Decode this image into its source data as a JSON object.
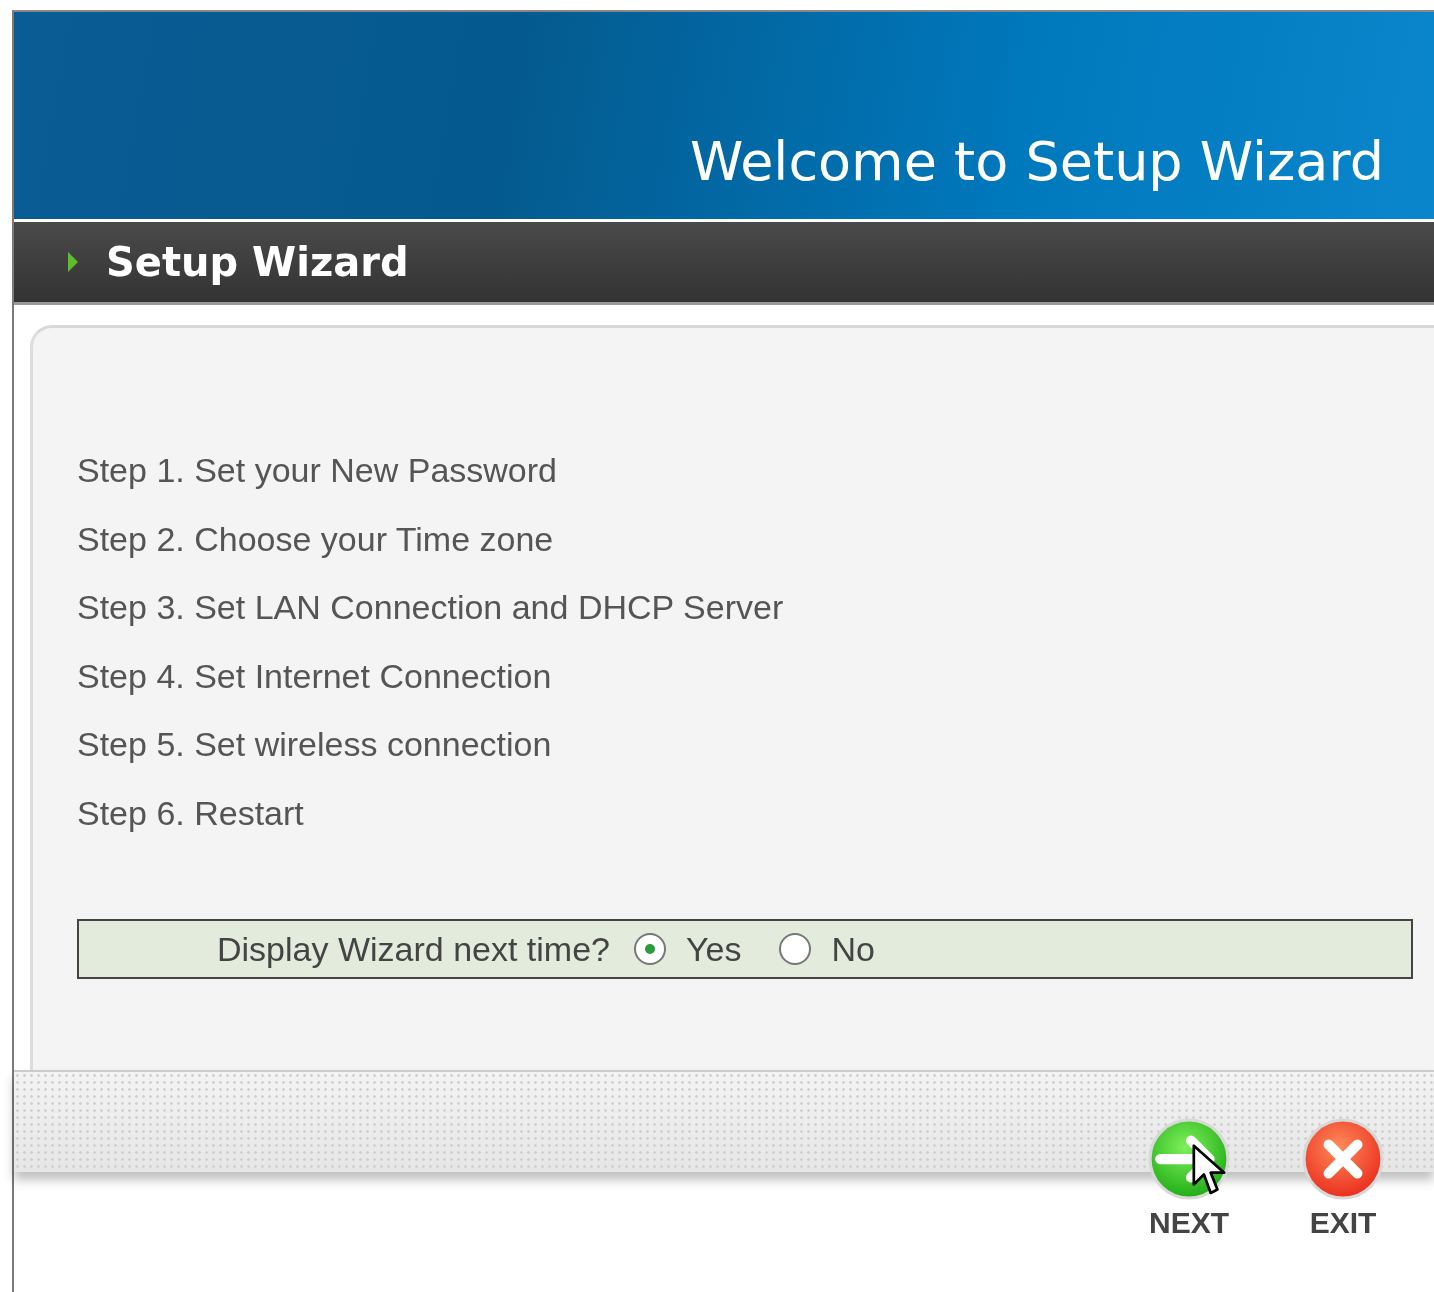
{
  "banner": {
    "title": "Welcome to Setup Wizard"
  },
  "section": {
    "title": "Setup Wizard"
  },
  "steps": [
    "Step 1. Set your New Password",
    "Step 2. Choose your Time zone",
    "Step 3. Set LAN Connection and DHCP Server",
    "Step 4. Set Internet Connection",
    "Step 5. Set wireless connection",
    "Step 6. Restart"
  ],
  "wizard_prompt": {
    "label": "Display Wizard next time?",
    "options": [
      {
        "label": "Yes",
        "selected": true
      },
      {
        "label": "No",
        "selected": false
      }
    ]
  },
  "buttons": [
    {
      "kind": "next",
      "label": "NEXT"
    },
    {
      "kind": "exit",
      "label": "EXIT"
    }
  ]
}
